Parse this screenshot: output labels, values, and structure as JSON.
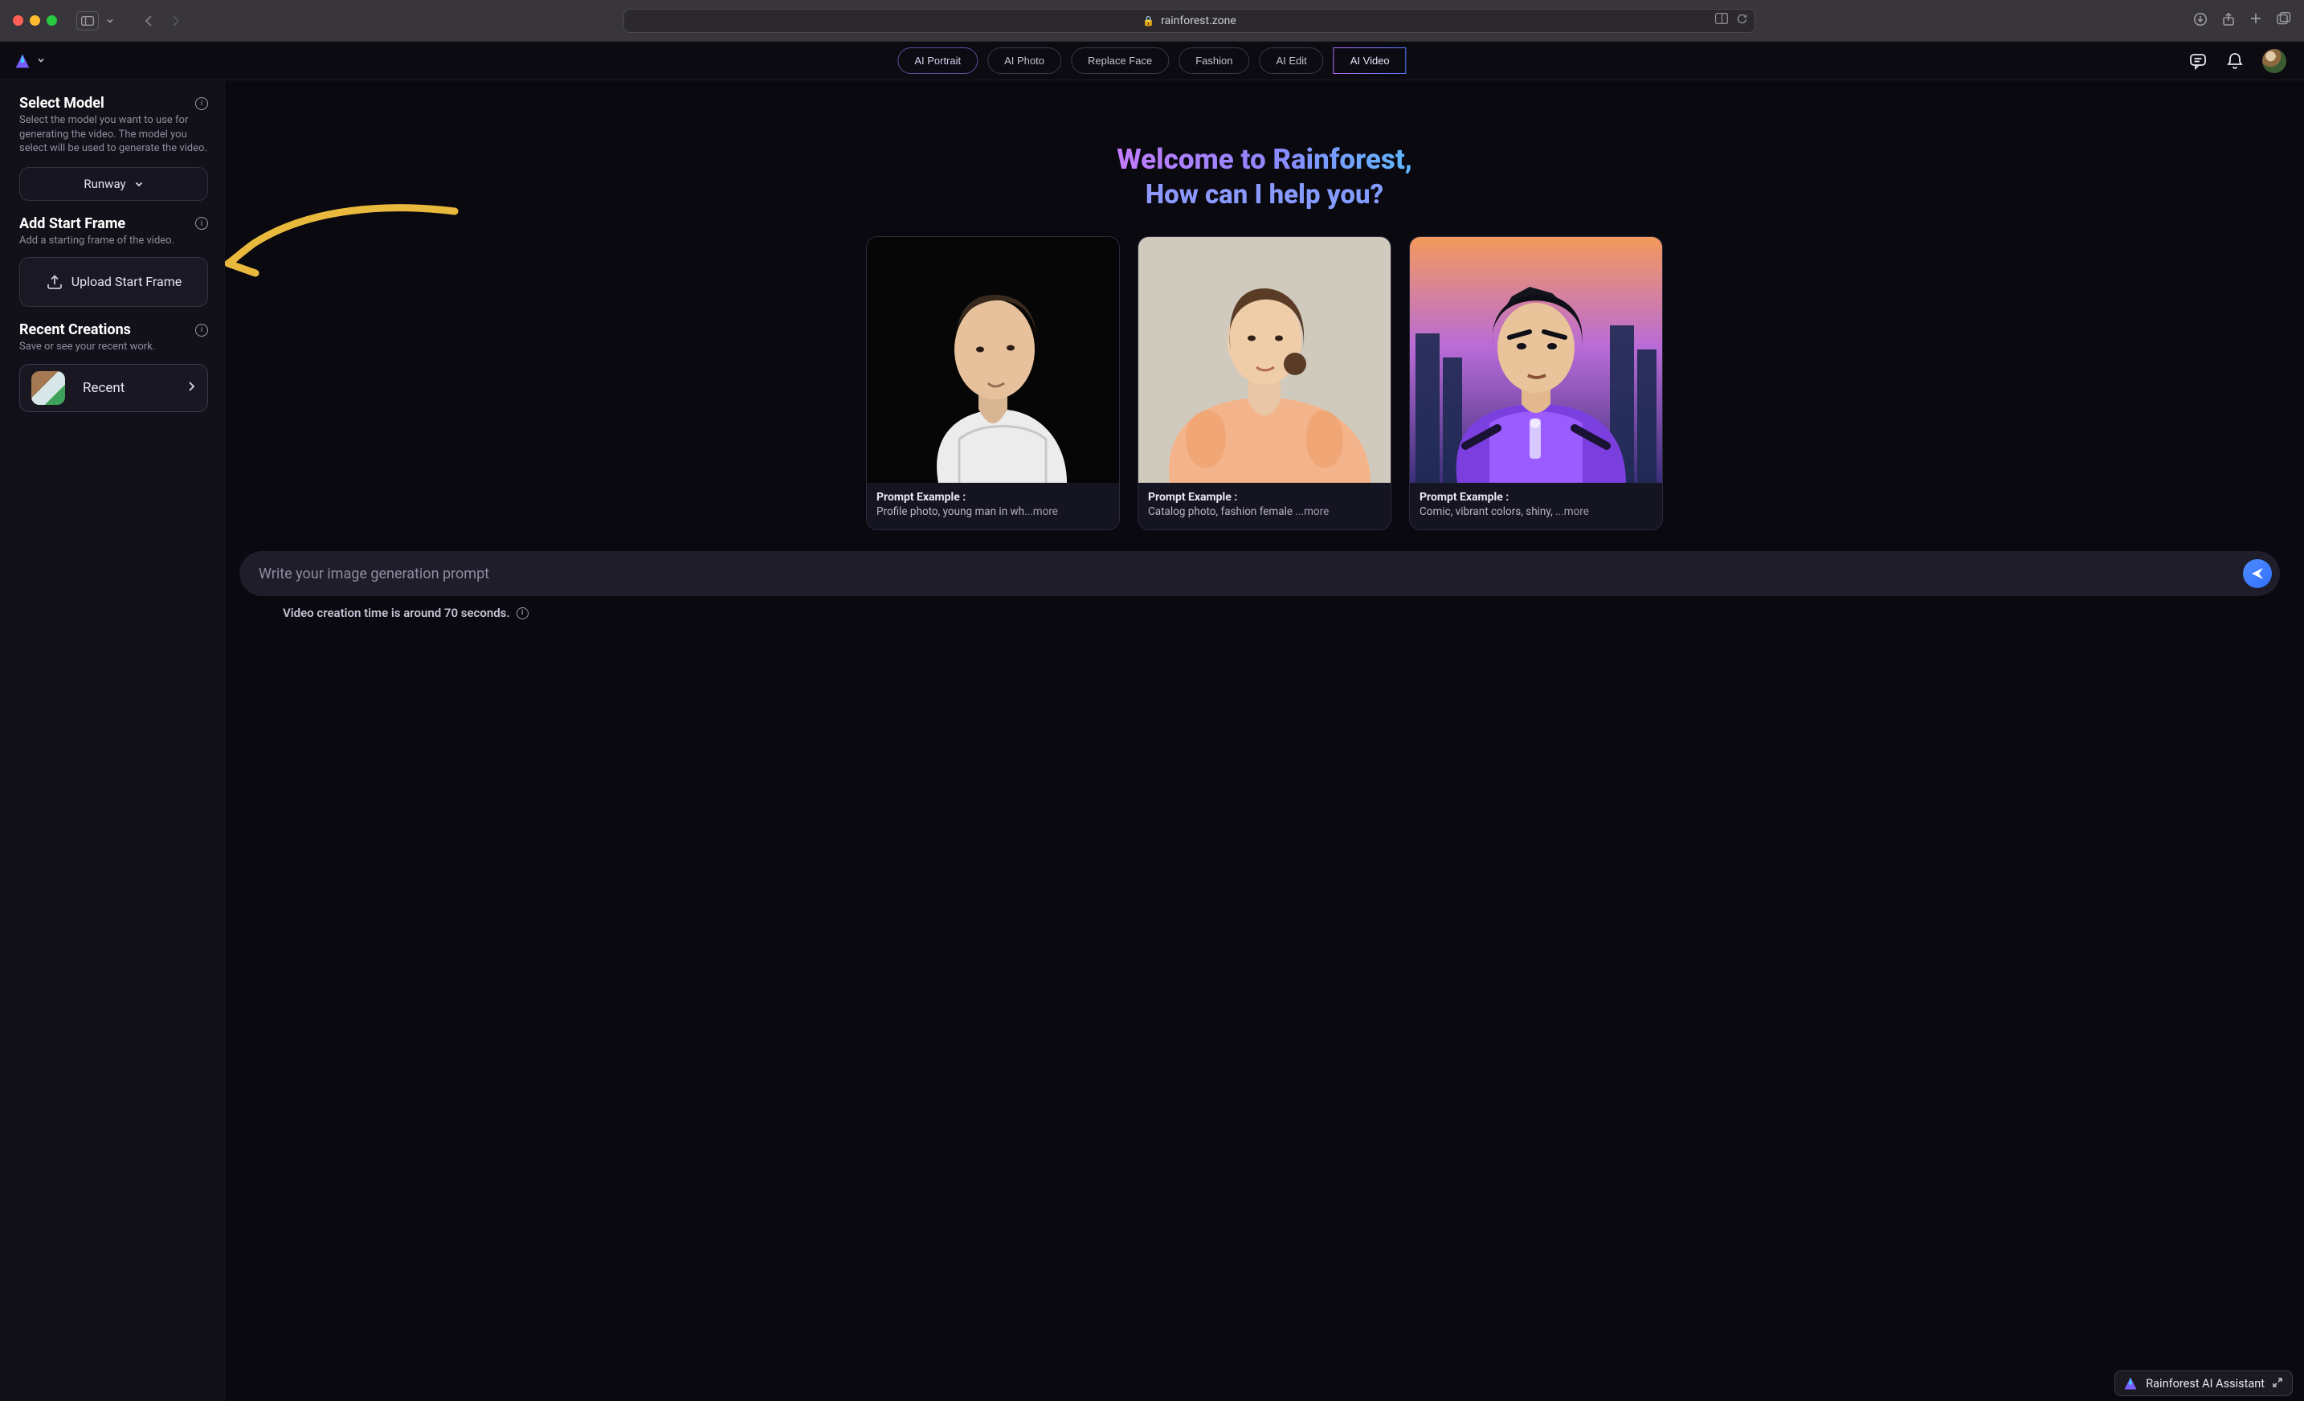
{
  "browser": {
    "domain": "rainforest.zone"
  },
  "header": {
    "nav": {
      "ai_portrait": "AI Portrait",
      "ai_photo": "AI Photo",
      "replace_face": "Replace Face",
      "fashion": "Fashion",
      "ai_edit": "AI Edit",
      "ai_video": "AI Video"
    }
  },
  "sidebar": {
    "select_model": {
      "title": "Select Model",
      "desc": "Select the model you want to use for generating the video. The model you select will be used to generate the video.",
      "selected": "Runway"
    },
    "start_frame": {
      "title": "Add Start Frame",
      "desc": "Add a starting frame of the video.",
      "button": "Upload Start Frame"
    },
    "recent": {
      "title": "Recent Creations",
      "desc": "Save or see your recent work.",
      "button": "Recent"
    }
  },
  "hero": {
    "line1": "Welcome to Rainforest,",
    "line2": "How can I help you?"
  },
  "cards": [
    {
      "title": "Prompt Example :",
      "text": "Profile photo, young man in wh",
      "more": "...more"
    },
    {
      "title": "Prompt Example :",
      "text": "Catalog photo, fashion female ",
      "more": "...more"
    },
    {
      "title": "Prompt Example :",
      "text": "Comic, vibrant colors, shiny, ",
      "more": "...more"
    }
  ],
  "prompt": {
    "placeholder": "Write your image generation prompt",
    "timing": "Video creation time is around 70 seconds."
  },
  "assistant": {
    "label": "Rainforest AI Assistant"
  }
}
